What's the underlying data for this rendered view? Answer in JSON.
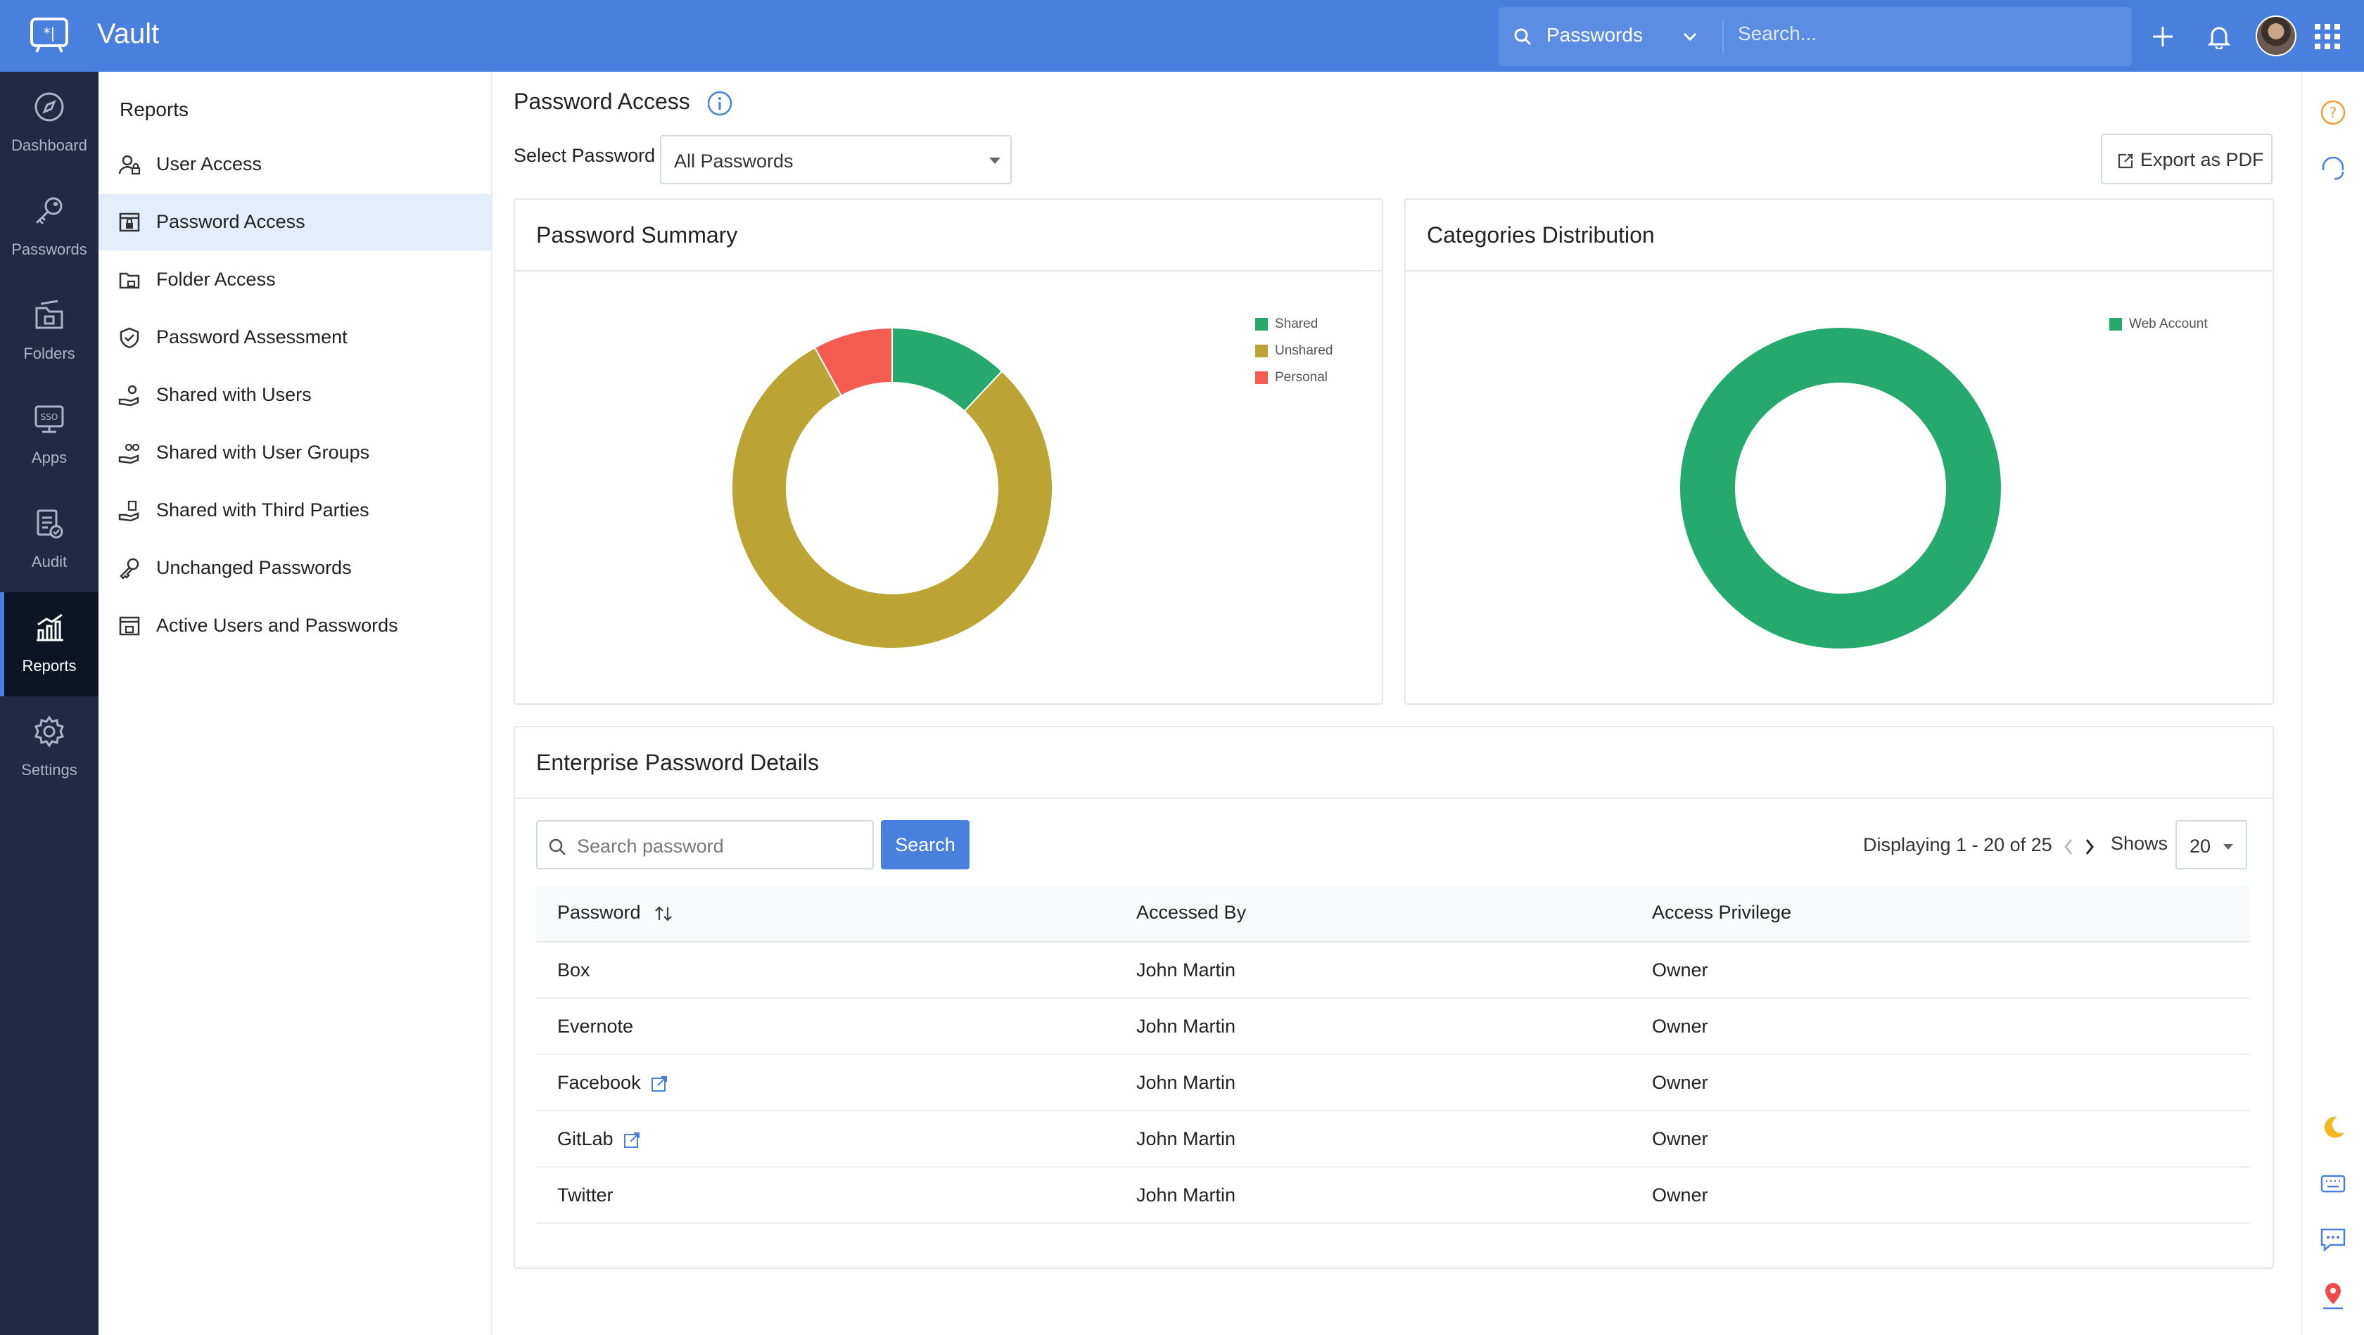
{
  "app": {
    "title": "Vault"
  },
  "topbar": {
    "search_scope": "Passwords",
    "search_placeholder": "Search..."
  },
  "rail": {
    "items": [
      {
        "label": "Dashboard",
        "icon": "compass-icon"
      },
      {
        "label": "Passwords",
        "icon": "key-icon"
      },
      {
        "label": "Folders",
        "icon": "folder-icon"
      },
      {
        "label": "Apps",
        "icon": "sso-monitor-icon"
      },
      {
        "label": "Audit",
        "icon": "audit-icon"
      },
      {
        "label": "Reports",
        "icon": "chart-icon",
        "active": true
      },
      {
        "label": "Settings",
        "icon": "gear-icon"
      }
    ]
  },
  "subnav": {
    "title": "Reports",
    "items": [
      {
        "label": "User Access",
        "icon": "user-lock-icon"
      },
      {
        "label": "Password Access",
        "icon": "password-lock-icon",
        "active": true
      },
      {
        "label": "Folder Access",
        "icon": "folder-lock-icon"
      },
      {
        "label": "Password Assessment",
        "icon": "shield-check-icon"
      },
      {
        "label": "Shared with Users",
        "icon": "hand-share-icon"
      },
      {
        "label": "Shared with User Groups",
        "icon": "hand-group-icon"
      },
      {
        "label": "Shared with Third Parties",
        "icon": "hand-third-party-icon"
      },
      {
        "label": "Unchanged Passwords",
        "icon": "wrench-key-icon"
      },
      {
        "label": "Active Users and Passwords",
        "icon": "active-users-icon"
      }
    ]
  },
  "main": {
    "page_title": "Password Access",
    "select_label": "Select Password",
    "select_value": "All Passwords",
    "export_label": "Export as PDF",
    "summary_card": {
      "title": "Password Summary"
    },
    "categories_card": {
      "title": "Categories Distribution"
    },
    "details": {
      "title": "Enterprise Password Details",
      "search_placeholder": "Search password",
      "search_button": "Search",
      "pagination_text": "Displaying 1 - 20 of 25",
      "shows_label": "Shows",
      "shows_value": "20",
      "columns": [
        "Password",
        "Accessed By",
        "Access Privilege"
      ],
      "rows": [
        {
          "password": "Box",
          "accessed_by": "John Martin",
          "privilege": "Owner",
          "external": false
        },
        {
          "password": "Evernote",
          "accessed_by": "John Martin",
          "privilege": "Owner",
          "external": false
        },
        {
          "password": "Facebook",
          "accessed_by": "John Martin",
          "privilege": "Owner",
          "external": true
        },
        {
          "password": "GitLab",
          "accessed_by": "John Martin",
          "privilege": "Owner",
          "external": true
        },
        {
          "password": "Twitter",
          "accessed_by": "John Martin",
          "privilege": "Owner",
          "external": false
        }
      ]
    }
  },
  "colors": {
    "header": "#4a80dd",
    "rail": "#1f2a44",
    "shared": "#26a96c",
    "unshared": "#bba433",
    "personal": "#f45c51",
    "web_account": "#26a96c"
  },
  "chart_data": [
    {
      "type": "pie",
      "title": "Password Summary",
      "donut": true,
      "legend_position": "top-right",
      "categories": [
        "Shared",
        "Unshared",
        "Personal"
      ],
      "values": [
        3,
        20,
        2
      ],
      "colors": [
        "#26a96c",
        "#bba433",
        "#f45c51"
      ]
    },
    {
      "type": "pie",
      "title": "Categories Distribution",
      "donut": true,
      "legend_position": "top-right",
      "categories": [
        "Web Account"
      ],
      "values": [
        25
      ],
      "colors": [
        "#26a96c"
      ]
    }
  ]
}
